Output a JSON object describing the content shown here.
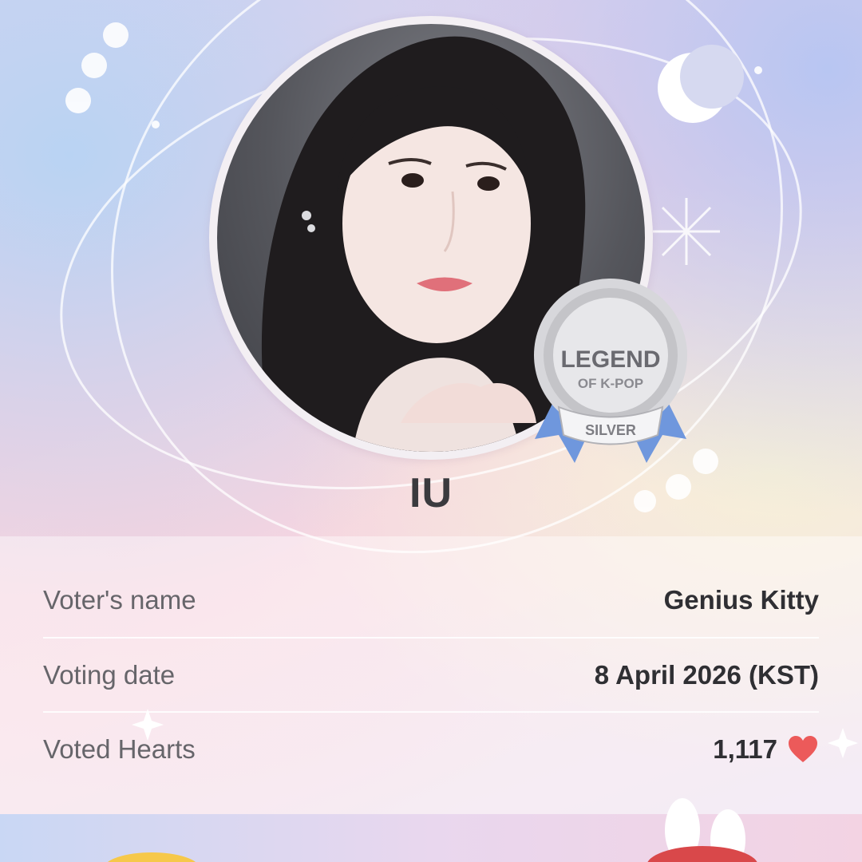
{
  "idol": {
    "name": "IU",
    "photo_alt": "IU"
  },
  "badge": {
    "line1": "LEGEND",
    "line2": "OF K-POP",
    "tier": "SILVER",
    "color": "#b9b9bd",
    "ribbon_color": "#6f97dd"
  },
  "vote_info": {
    "rows": [
      {
        "label": "Voter's name",
        "value": "Genius Kitty"
      },
      {
        "label": "Voting date",
        "value": "8 April 2026 (KST)"
      },
      {
        "label": "Voted Hearts",
        "value": "1,117",
        "icon": "heart-icon"
      }
    ]
  },
  "colors": {
    "heart": "#ec5a5a",
    "name_text": "#3a3a3e"
  }
}
